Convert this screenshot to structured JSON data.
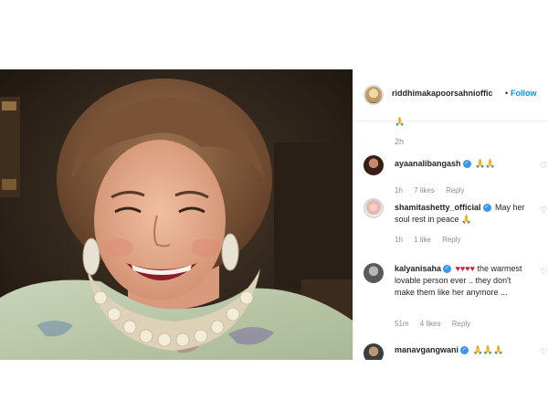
{
  "post": {
    "username": "riddhimakapoorsahnioffic",
    "dot": "•",
    "follow_label": "Follow",
    "caption_emoji": "🙏",
    "caption_time": "2h"
  },
  "comments": [
    {
      "username": "ayaanalibangash",
      "text": "🙏🙏",
      "time": "1h",
      "likes": "7 likes",
      "reply": "Reply"
    },
    {
      "username": "shamitashetty_official",
      "text": "May her soul rest in peace 🙏",
      "time": "1h",
      "likes": "1 like",
      "reply": "Reply"
    },
    {
      "username": "kalyanisaha",
      "hearts": "♥♥♥♥",
      "text": "the warmest lovable person ever .. they don't make them like her anymore ...",
      "time": "51m",
      "likes": "4 likes",
      "reply": "Reply"
    },
    {
      "username": "manavgangwani",
      "text": "🙏🙏🙏"
    }
  ],
  "colors": {
    "link_blue": "#0095f6",
    "verified_blue": "#3897f0",
    "meta_gray": "#8e8e8e",
    "text_dark": "#262626"
  }
}
